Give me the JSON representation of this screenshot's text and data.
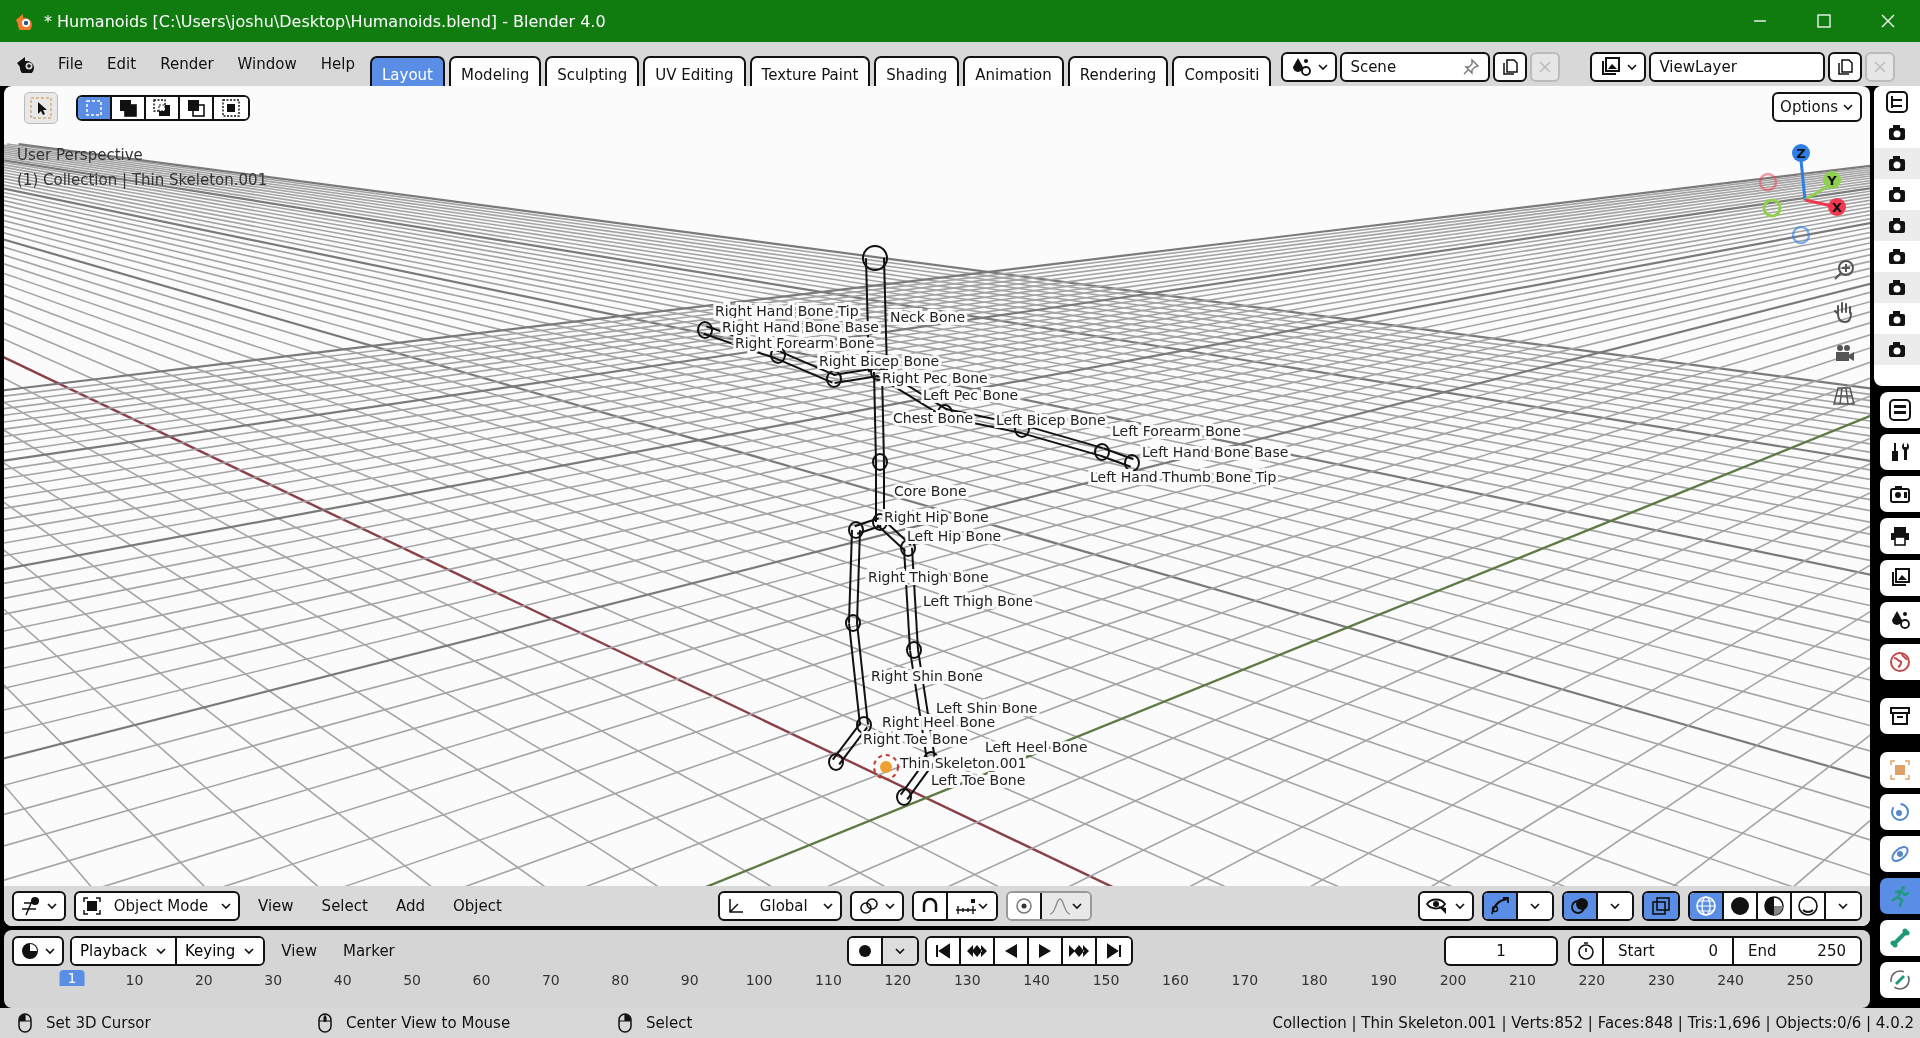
{
  "window": {
    "title": "* Humanoids [C:\\Users\\joshu\\Desktop\\Humanoids.blend] - Blender 4.0"
  },
  "menu": [
    "File",
    "Edit",
    "Render",
    "Window",
    "Help"
  ],
  "workspace_tabs": [
    {
      "label": "Layout",
      "selected": true
    },
    {
      "label": "Modeling",
      "selected": false
    },
    {
      "label": "Sculpting",
      "selected": false
    },
    {
      "label": "UV Editing",
      "selected": false
    },
    {
      "label": "Texture Paint",
      "selected": false
    },
    {
      "label": "Shading",
      "selected": false
    },
    {
      "label": "Animation",
      "selected": false
    },
    {
      "label": "Rendering",
      "selected": false
    },
    {
      "label": "Compositi",
      "selected": false
    }
  ],
  "scene": {
    "name": "Scene"
  },
  "view_layer": {
    "name": "ViewLayer"
  },
  "viewport": {
    "select_modes": [
      {
        "kind": "set",
        "selected": true
      },
      {
        "kind": "extend",
        "selected": false
      },
      {
        "kind": "subtract",
        "selected": false
      },
      {
        "kind": "invert",
        "selected": false
      },
      {
        "kind": "intersect",
        "selected": false
      }
    ],
    "options": "Options",
    "view_name": "User Perspective",
    "collection_info": "(1) Collection | Thin Skeleton.001",
    "axes": [
      {
        "label": "Z",
        "color": "#2e7ee6"
      },
      {
        "label": "Y",
        "color": "#8fd14f"
      },
      {
        "label": "X",
        "color": "#f0384f"
      }
    ],
    "bone_labels": [
      "Neck Bone",
      "Right Hand Bone Tip",
      "Right Hand Bone Base",
      "Right Forearm Bone",
      "Right Bicep Bone",
      "Right Pec Bone",
      "Left Pec Bone",
      "Chest Bone",
      "Left Bicep Bone",
      "Left Forearm Bone",
      "Left Hand Bone Base",
      "Left Hand Thumb Bone Tip",
      "Core Bone",
      "Right Hip Bone",
      "Left Hip Bone",
      "Right Thigh Bone",
      "Left Thigh Bone",
      "Right Shin Bone",
      "Left Shin Bone",
      "Right Heel Bone",
      "Right Toe Bone",
      "Thin Skeleton.001",
      "Left Heel Bone",
      "Left Toe Bone"
    ],
    "header": {
      "mode": "Object Mode",
      "menus": [
        "View",
        "Select",
        "Add",
        "Object"
      ],
      "orientation": "Global",
      "snap": false,
      "proportional_editing": false,
      "gizmos": true,
      "overlays": true,
      "xray": true,
      "shading_modes": [
        {
          "kind": "wireframe",
          "selected": true
        },
        {
          "kind": "solid",
          "selected": false
        },
        {
          "kind": "material",
          "selected": false
        },
        {
          "kind": "rendered",
          "selected": false
        }
      ]
    }
  },
  "timeline": {
    "dropdowns": [
      "Playback",
      "Keying"
    ],
    "menus": [
      "View",
      "Marker"
    ],
    "auto_keying": false,
    "current_frame": "1",
    "start_label": "Start",
    "start": "0",
    "end_label": "End",
    "end": "250",
    "ruler": [
      {
        "label": "1",
        "selected": true
      },
      {
        "label": "10",
        "selected": false
      },
      {
        "label": "20",
        "selected": false
      },
      {
        "label": "30",
        "selected": false
      },
      {
        "label": "40",
        "selected": false
      },
      {
        "label": "50",
        "selected": false
      },
      {
        "label": "60",
        "selected": false
      },
      {
        "label": "70",
        "selected": false
      },
      {
        "label": "80",
        "selected": false
      },
      {
        "label": "90",
        "selected": false
      },
      {
        "label": "100",
        "selected": false
      },
      {
        "label": "110",
        "selected": false
      },
      {
        "label": "120",
        "selected": false
      },
      {
        "label": "130",
        "selected": false
      },
      {
        "label": "140",
        "selected": false
      },
      {
        "label": "150",
        "selected": false
      },
      {
        "label": "160",
        "selected": false
      },
      {
        "label": "170",
        "selected": false
      },
      {
        "label": "180",
        "selected": false
      },
      {
        "label": "190",
        "selected": false
      },
      {
        "label": "200",
        "selected": false
      },
      {
        "label": "210",
        "selected": false
      },
      {
        "label": "220",
        "selected": false
      },
      {
        "label": "230",
        "selected": false
      },
      {
        "label": "240",
        "selected": false
      },
      {
        "label": "250",
        "selected": false
      }
    ]
  },
  "status_bar": {
    "hints": [
      {
        "kind": "left_click",
        "label": "Set 3D Cursor"
      },
      {
        "kind": "middle_click",
        "label": "Center View to Mouse"
      },
      {
        "kind": "right_click",
        "label": "Select"
      }
    ],
    "stats": "Collection | Thin Skeleton.001 | Verts:852 | Faces:848 | Tris:1,696 | Objects:0/6 | 4.0.2"
  },
  "outliner": {
    "rows": [
      {
        "render_enabled": true
      },
      {
        "render_enabled": true
      },
      {
        "render_enabled": true
      },
      {
        "render_enabled": true
      },
      {
        "render_enabled": true
      },
      {
        "render_enabled": true
      },
      {
        "render_enabled": true
      },
      {
        "render_enabled": true
      }
    ]
  },
  "properties_tabs": [
    {
      "kind": "tool",
      "selected": false
    },
    {
      "kind": "render",
      "selected": false
    },
    {
      "kind": "output",
      "selected": false
    },
    {
      "kind": "view_layer",
      "selected": false
    },
    {
      "kind": "scene",
      "selected": false
    },
    {
      "kind": "world",
      "selected": false
    },
    {
      "kind": "collection",
      "selected": false
    },
    {
      "kind": "object",
      "selected": false
    },
    {
      "kind": "particles",
      "selected": false
    },
    {
      "kind": "physics",
      "selected": false
    },
    {
      "kind": "armature",
      "selected": true
    },
    {
      "kind": "bone",
      "selected": false
    },
    {
      "kind": "bone_constraints",
      "selected": false
    }
  ]
}
